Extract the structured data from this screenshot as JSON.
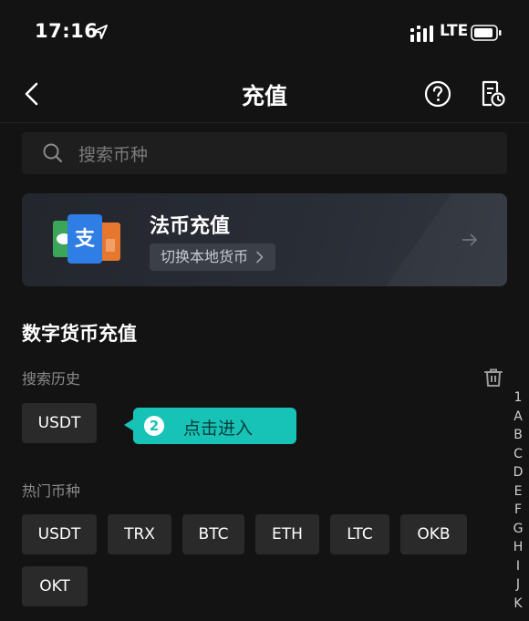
{
  "status_bar": {
    "time": "17:16",
    "network": "LTE"
  },
  "header": {
    "title": "充值"
  },
  "search": {
    "placeholder": "搜索币种"
  },
  "fiat_card": {
    "title": "法币充值",
    "switch_label": "切换本地货币"
  },
  "crypto_section": {
    "title": "数字货币充值",
    "history_label": "搜索历史",
    "history_items": [
      "USDT"
    ],
    "hot_label": "热门币种",
    "hot_items": [
      "USDT",
      "TRX",
      "BTC",
      "ETH",
      "LTC",
      "OKB",
      "OKT"
    ]
  },
  "tooltip": {
    "step": "2",
    "text": "点击进入"
  },
  "index": [
    "1",
    "A",
    "B",
    "C",
    "D",
    "E",
    "F",
    "G",
    "H",
    "I",
    "J",
    "K"
  ],
  "colors": {
    "accent": "#17c3b7",
    "background": "#131313",
    "chip": "#2a2a2a"
  }
}
